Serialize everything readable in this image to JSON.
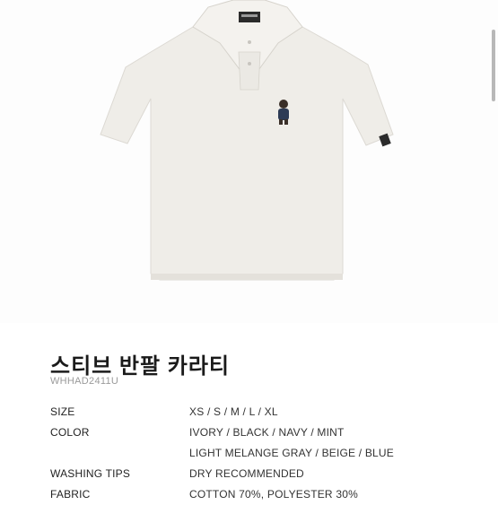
{
  "product": {
    "title": "스티브 반팔 카라티",
    "code": "WHHAD2411U"
  },
  "specs": [
    {
      "label": "SIZE",
      "values": [
        "XS / S / M / L / XL"
      ]
    },
    {
      "label": "COLOR",
      "values": [
        "IVORY / BLACK / NAVY / MINT",
        "LIGHT MELANGE GRAY / BEIGE / BLUE"
      ]
    },
    {
      "label": "WASHING TIPS",
      "values": [
        "DRY RECOMMENDED"
      ]
    },
    {
      "label": "FABRIC",
      "values": [
        "COTTON 70%, POLYESTER 30%"
      ]
    }
  ],
  "image": {
    "subject": "ivory polo shirt with bear logo",
    "shirt_color": "#efede8",
    "logo_icon": "bear-logo-icon"
  }
}
